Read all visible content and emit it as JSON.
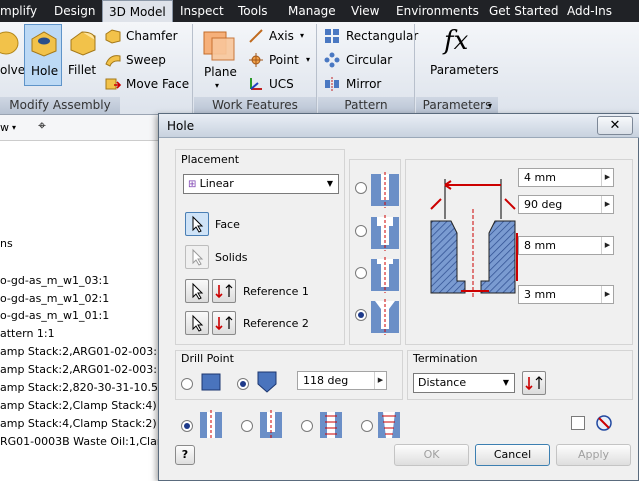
{
  "menubar": {
    "tabs": [
      "mplify",
      "Design",
      "3D Model",
      "Inspect",
      "Tools",
      "Manage",
      "View",
      "Environments",
      "Get Started",
      "Add-Ins"
    ],
    "active": "3D Model"
  },
  "ribbon": {
    "modify": {
      "olve": "olve",
      "hole": "Hole",
      "fillet": "Fillet",
      "chamfer": "Chamfer",
      "sweep": "Sweep",
      "move_face": "Move Face",
      "panel": "Modify Assembly"
    },
    "work": {
      "plane": "Plane",
      "axis": "Axis",
      "point": "Point",
      "ucs": "UCS",
      "panel": "Work Features"
    },
    "pattern": {
      "rectangular": "Rectangular",
      "circular": "Circular",
      "mirror": "Mirror",
      "panel": "Pattern"
    },
    "parameters": {
      "fx": "fx",
      "label": "Parameters",
      "panel": "Parameters"
    }
  },
  "browser": {
    "view_label": "w",
    "items": [
      "ns",
      "o-gd-as_m_w1_03:1",
      "o-gd-as_m_w1_02:1",
      "o-gd-as_m_w1_01:1",
      "attern 1:1",
      "amp Stack:2,ARG01-02-003:1)",
      "amp Stack:2,ARG01-02-003:1) (7",
      "amp Stack:2,820-30-31-10.5A:13",
      "amp Stack:2,Clamp Stack:4) (748.",
      "amp Stack:4,Clamp Stack:2)",
      "RG01-0003B Waste Oil:1,Clamp St"
    ]
  },
  "dialog": {
    "title": "Hole",
    "placement": {
      "label": "Placement",
      "type": "Linear",
      "face": "Face",
      "solids": "Solids",
      "reference1": "Reference 1",
      "reference2": "Reference 2"
    },
    "dims": {
      "d1": "4 mm",
      "d2": "90 deg",
      "d3": "8 mm",
      "d4": "3 mm"
    },
    "drill_point": {
      "label": "Drill Point",
      "angle": "118 deg"
    },
    "termination": {
      "label": "Termination",
      "value": "Distance"
    },
    "buttons": {
      "ok": "OK",
      "cancel": "Cancel",
      "apply": "Apply",
      "help": "?",
      "close": "✕"
    }
  }
}
